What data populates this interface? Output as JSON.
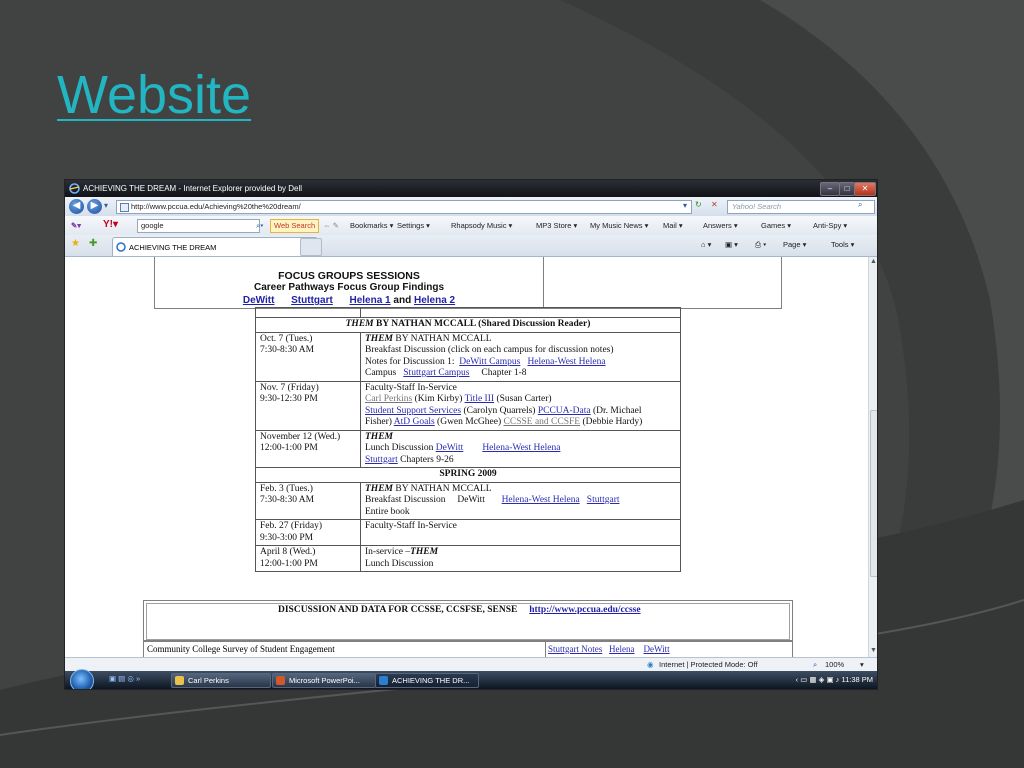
{
  "slide": {
    "title": "Website"
  },
  "browser": {
    "window_title": "ACHIEVING THE DREAM - Internet Explorer provided by Dell",
    "window_buttons": [
      "–",
      "□",
      "✕"
    ],
    "url": "http://www.pccua.edu/Achieving%20the%20dream/",
    "search_placeholder": "Yahoo! Search",
    "toolbar": {
      "google_query": "google",
      "web_search": "Web Search",
      "items": [
        "Bookmarks ▾",
        "Settings ▾",
        "Rhapsody Music ▾",
        "MP3 Store ▾",
        "My Music News ▾",
        "Mail ▾",
        "Answers ▾",
        "Games ▾",
        "Anti-Spy ▾"
      ]
    },
    "tab_label": "ACHIEVING THE DREAM",
    "commands": [
      "Page ▾",
      "Tools ▾"
    ],
    "status": {
      "zone": "Internet | Protected Mode: Off",
      "zoom": "100%"
    }
  },
  "page": {
    "focus": {
      "heading": "FOCUS GROUPS SESSIONS",
      "subheading": "Career Pathways Focus Group Findings",
      "links": [
        "DeWitt",
        "Stuttgart",
        "Helena 1"
      ],
      "and": "and",
      "last_link": "Helena 2"
    },
    "schedule": {
      "header_em": "THEM",
      "header_rest": " BY NATHAN MCCALL (Shared Discussion Reader)",
      "r1_date": "Oct. 7 (Tues.)",
      "r1_time": "7:30-8:30 AM",
      "r1_em": "THEM",
      "r1_title_rest": " BY NATHAN MCCALL",
      "r1_line2": "Breakfast Discussion    (click on each campus for discussion notes)",
      "r1_notes": "Notes for Discussion 1:",
      "r1_link1": "DeWitt Campus",
      "r1_link2": "Helena-West Helena",
      "r1_campus": "Campus",
      "r1_link3": "Stuttgart Campus",
      "r1_chapters": "Chapter 1-8",
      "r2_date": "Nov. 7 (Friday)",
      "r2_time": "9:30-12:30 PM",
      "r2_line1": "Faculty-Staff In-Service",
      "r2_link_cp": "Carl Perkins",
      "r2_cp_person": " (Kim Kirby) ",
      "r2_link_t3": "Title III",
      "r2_t3_person": " (Susan Carter)",
      "r2_link_sss": "Student Support Services",
      "r2_sss_person": " (Carolyn Quarrels) ",
      "r2_link_pd": "PCCUA-Data",
      "r2_pd_person": " (Dr. Michael",
      "r2_fisher": "Fisher) ",
      "r2_link_atd": "AtD Goals",
      "r2_atd_person": " (Gwen McGhee) ",
      "r2_link_ccsse": "CCSSE and CCSFE",
      "r2_ccsse_person": " (Debbie Hardy)",
      "r3_date": "November 12 (Wed.)",
      "r3_time": "12:00-1:00 PM",
      "r3_em": "THEM",
      "r3_lunch": "Lunch Discussion ",
      "r3_link1": "DeWitt",
      "r3_link2": "Helena-West Helena",
      "r3_link3": "Stuttgart",
      "r3_chapters": " Chapters 9-26",
      "spring": "SPRING 2009",
      "r4_date": "Feb. 3  (Tues.)",
      "r4_time": "7:30-8:30 AM",
      "r4_em": "THEM",
      "r4_title_rest": " BY NATHAN MCCALL",
      "r4_breakfast": "Breakfast Discussion     DeWitt      ",
      "r4_link1": "Helena-West Helena",
      "r4_link2": "Stuttgart",
      "r4_book": "Entire book",
      "r5_date": "Feb. 27 (Friday)",
      "r5_time": "9:30-3:00 PM",
      "r5_line1": "Faculty-Staff In-Service",
      "r6_date": "April 8 (Wed.)",
      "r6_time": "12:00-1:00 PM",
      "r6_pre": "In-service –",
      "r6_em": "THEM",
      "r6_line2": "Lunch Discussion"
    },
    "discussion": {
      "heading": "DISCUSSION AND DATA FOR CCSSE, CCSFSE, SENSE",
      "link": "http://www.pccua.edu/ccsse",
      "row_label": "Community College Survey of Student Engagement",
      "row_links": [
        "Stuttgart Notes",
        "Helena",
        "DeWitt"
      ]
    }
  },
  "taskbar": {
    "tasks": [
      "Carl Perkins",
      "Microsoft PowerPoi...",
      "ACHIEVING THE DR..."
    ],
    "clock": "11:38 PM"
  }
}
